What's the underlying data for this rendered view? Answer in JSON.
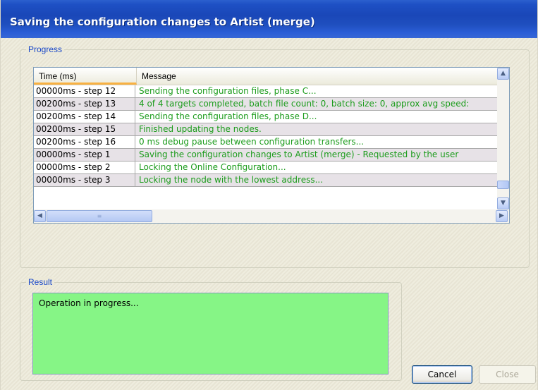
{
  "window": {
    "title": "Saving the configuration changes to Artist (merge)"
  },
  "progress": {
    "group_label": "Progress",
    "columns": [
      "Time (ms)",
      "Message"
    ],
    "rows": [
      {
        "time": "00000ms - step 12",
        "message": "Sending the configuration files, phase C..."
      },
      {
        "time": "00200ms - step 13",
        "message": "4 of 4 targets completed, batch file count: 0, batch size: 0, approx avg speed:"
      },
      {
        "time": "00200ms - step 14",
        "message": "Sending the configuration files, phase D..."
      },
      {
        "time": "00200ms - step 15",
        "message": "Finished updating the nodes."
      },
      {
        "time": "00200ms - step 16",
        "message": "0 ms debug pause between configuration transfers..."
      },
      {
        "time": "00000ms - step 1",
        "message": "Saving the configuration changes to Artist (merge) - Requested by the user"
      },
      {
        "time": "00000ms - step 2",
        "message": "Locking the Online Configuration..."
      },
      {
        "time": "00000ms - step 3",
        "message": "Locking the node with the lowest address..."
      }
    ],
    "scroll_icons": {
      "up": "chevron-up-icon",
      "down": "chevron-down-icon",
      "left": "chevron-left-icon",
      "right": "chevron-right-icon"
    }
  },
  "result": {
    "group_label": "Result",
    "text": "Operation in progress...",
    "background_color": "#86f586"
  },
  "buttons": {
    "cancel": "Cancel",
    "close": "Close"
  },
  "colors": {
    "message_text": "#1c9c1c",
    "titlebar": "#1a47b8",
    "group_label": "#1847c9"
  }
}
